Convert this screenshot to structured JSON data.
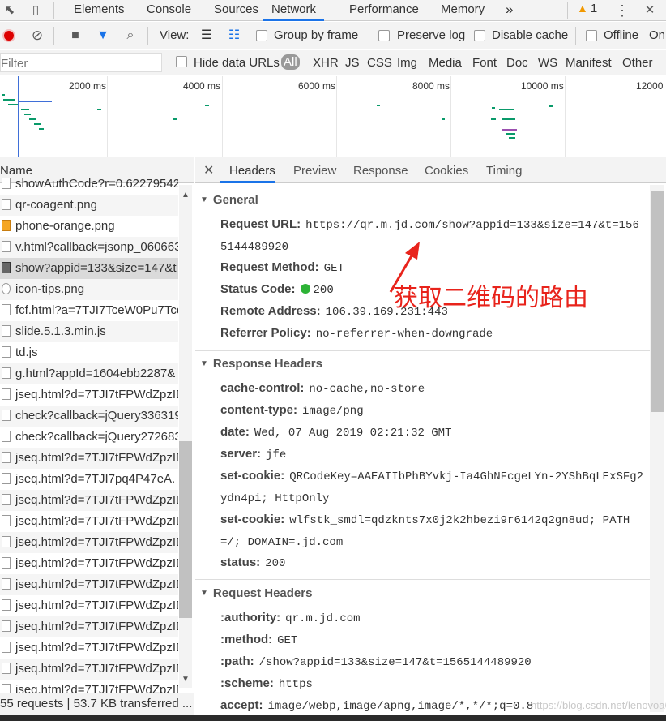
{
  "tabbar": {
    "tabs": [
      "Elements",
      "Console",
      "Sources",
      "Network",
      "Performance",
      "Memory"
    ],
    "active": "Network",
    "more": "»",
    "warning_count": "1",
    "menu": "⋮",
    "close": "✕"
  },
  "toolbar": {
    "view_label": "View:",
    "group_by_frame": "Group by frame",
    "preserve_log": "Preserve log",
    "disable_cache": "Disable cache",
    "offline": "Offline",
    "online": "On"
  },
  "filterbar": {
    "filter_placeholder": "Filter",
    "hide_data_urls": "Hide data URLs",
    "types": [
      "All",
      "XHR",
      "JS",
      "CSS",
      "Img",
      "Media",
      "Font",
      "Doc",
      "WS",
      "Manifest",
      "Other"
    ]
  },
  "overview": {
    "ticks": [
      "2000 ms",
      "4000 ms",
      "6000 ms",
      "8000 ms",
      "10000 ms",
      "12000"
    ],
    "colors": {
      "domcontentloaded": "#3f6fd8",
      "load": "#e34b4b",
      "bar": "#0a9a6a"
    }
  },
  "request_list": {
    "header": "Name",
    "selected_index": 4,
    "rows": [
      {
        "name": "showAuthCode?r=0.62279542",
        "icon": "doc"
      },
      {
        "name": "qr-coagent.png",
        "icon": "doc"
      },
      {
        "name": "phone-orange.png",
        "icon": "img"
      },
      {
        "name": "v.html?callback=jsonp_060663",
        "icon": "doc"
      },
      {
        "name": "show?appid=133&size=147&t",
        "icon": "qr"
      },
      {
        "name": "icon-tips.png",
        "icon": "round"
      },
      {
        "name": "fcf.html?a=7TJI7TceW0Pu7Tce.",
        "icon": "doc"
      },
      {
        "name": "slide.5.1.3.min.js",
        "icon": "doc"
      },
      {
        "name": "td.js",
        "icon": "doc"
      },
      {
        "name": "g.html?appId=1604ebb2287&",
        "icon": "doc"
      },
      {
        "name": "jseq.html?d=7TJI7tFPWdZpzID",
        "icon": "doc"
      },
      {
        "name": "check?callback=jQuery336319",
        "icon": "doc"
      },
      {
        "name": "check?callback=jQuery272683",
        "icon": "doc"
      },
      {
        "name": "jseq.html?d=7TJI7tFPWdZpzID",
        "icon": "doc"
      },
      {
        "name": "jseq.html?d=7TJI7pq4P47eA.",
        "icon": "doc"
      },
      {
        "name": "jseq.html?d=7TJI7tFPWdZpzID",
        "icon": "doc"
      },
      {
        "name": "jseq.html?d=7TJI7tFPWdZpzID",
        "icon": "doc"
      },
      {
        "name": "jseq.html?d=7TJI7tFPWdZpzID",
        "icon": "doc"
      },
      {
        "name": "jseq.html?d=7TJI7tFPWdZpzID",
        "icon": "doc"
      },
      {
        "name": "jseq.html?d=7TJI7tFPWdZpzID",
        "icon": "doc"
      },
      {
        "name": "jseq.html?d=7TJI7tFPWdZpzID",
        "icon": "doc"
      },
      {
        "name": "jseq.html?d=7TJI7tFPWdZpzID",
        "icon": "doc"
      },
      {
        "name": "jseq.html?d=7TJI7tFPWdZpzID",
        "icon": "doc"
      },
      {
        "name": "jseq.html?d=7TJI7tFPWdZpzID",
        "icon": "doc"
      },
      {
        "name": "jseq.html?d=7TJI7tFPWdZpzID",
        "icon": "doc"
      }
    ]
  },
  "statusbar": {
    "text": "55 requests | 53.7 KB transferred ..."
  },
  "details": {
    "tabs": [
      "Headers",
      "Preview",
      "Response",
      "Cookies",
      "Timing"
    ],
    "active_tab": "Headers",
    "close": "✕",
    "general": {
      "title": "General",
      "request_url_key": "Request URL:",
      "request_url": "https://qr.m.jd.com/show?appid=133&size=147&t=1565144489920",
      "request_method_key": "Request Method:",
      "request_method": "GET",
      "status_code_key": "Status Code:",
      "status_code": "200",
      "remote_address_key": "Remote Address:",
      "remote_address": "106.39.169.231:443",
      "referrer_policy_key": "Referrer Policy:",
      "referrer_policy": "no-referrer-when-downgrade"
    },
    "response_headers": {
      "title": "Response Headers",
      "items": [
        {
          "k": "cache-control:",
          "v": "no-cache,no-store"
        },
        {
          "k": "content-type:",
          "v": "image/png"
        },
        {
          "k": "date:",
          "v": "Wed, 07 Aug 2019 02:21:32 GMT"
        },
        {
          "k": "server:",
          "v": "jfe"
        },
        {
          "k": "set-cookie:",
          "v": "QRCodeKey=AAEAIIbPhBYvkj-Ia4GhNFcgeLYn-2YShBqLExSFg2ydn4pi; HttpOnly"
        },
        {
          "k": "set-cookie:",
          "v": "wlfstk_smdl=qdzknts7x0j2k2hbezi9r6142q2gn8ud; PATH=/; DOMAIN=.jd.com"
        },
        {
          "k": "status:",
          "v": "200"
        }
      ]
    },
    "request_headers": {
      "title": "Request Headers",
      "items": [
        {
          "k": ":authority:",
          "v": "qr.m.jd.com"
        },
        {
          "k": ":method:",
          "v": "GET"
        },
        {
          "k": ":path:",
          "v": "/show?appid=133&size=147&t=1565144489920"
        },
        {
          "k": ":scheme:",
          "v": "https"
        },
        {
          "k": "accept:",
          "v": "image/webp,image/apng,image/*,*/*;q=0.8"
        }
      ]
    }
  },
  "annotation": "获取二维码的路由",
  "watermark": "https://blog.csdn.net/lenovoa68"
}
